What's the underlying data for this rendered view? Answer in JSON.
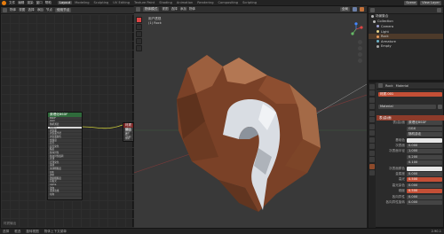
{
  "topbar": {
    "menus": [
      "文件",
      "编辑",
      "渲染",
      "窗口",
      "帮助"
    ],
    "workspaces": [
      "Layout",
      "Modeling",
      "Sculpting",
      "UV Editing",
      "Texture Paint",
      "Shading",
      "Animation",
      "Rendering",
      "Compositing",
      "Scripting"
    ],
    "active_workspace": "Layout",
    "scene_label": "Scene",
    "layer_label": "View Layer"
  },
  "node_editor": {
    "header_items": [
      "物体",
      "视图",
      "选择",
      "添加",
      "节点"
    ],
    "use_nodes_label": "使用节点",
    "node_main": {
      "title": "原理化BSDF",
      "rows": [
        "BSDF",
        "GGX",
        "随机游走",
        "基础色",
        "次表面",
        "次表面半径",
        "次表面颜色",
        "金属度",
        "高光",
        "高光染色",
        "糙度",
        "各向异性",
        "各向异性旋转",
        "光泽",
        "光泽染色",
        "清漆",
        "清漆粗糙度",
        "IOR",
        "透射",
        "透射粗糙度",
        "自发光",
        "Alpha",
        "法向",
        "清漆法线",
        "切向"
      ]
    },
    "node_output": {
      "title": "材质输出",
      "rows": [
        "全部",
        "表(曲)面",
        "体积(音量)",
        "置换"
      ]
    },
    "frame_label": "材质输出"
  },
  "viewport": {
    "header_items": [
      "物体模式",
      "视图",
      "选择",
      "添加",
      "物体"
    ],
    "shading_label": "全局",
    "overlay_text": [
      "用户透视",
      "(1) Rock"
    ]
  },
  "outliner": {
    "title": "场景集合",
    "rows": [
      {
        "label": "Collection",
        "kind": "collection"
      },
      {
        "label": "Camera",
        "kind": "camera"
      },
      {
        "label": "Light",
        "kind": "light"
      },
      {
        "label": "Rock",
        "kind": "mesh",
        "selected": true
      },
      {
        "label": "Armature",
        "kind": "armature"
      },
      {
        "label": "Empty",
        "kind": "empty"
      }
    ]
  },
  "properties": {
    "object_name": "Rock",
    "material_name": "Material",
    "slot_name": "材质.001",
    "section_surface": "表(曲)面",
    "surface_label": "表(曲)面",
    "surface_value": "原理化BSDF",
    "distribution_value": "GGX",
    "subsurface_method": "随机游走",
    "rows": [
      {
        "label": "基础色",
        "value": "",
        "style": "white"
      },
      {
        "label": "次表面",
        "value": "0.000",
        "style": ""
      },
      {
        "label": "次表面半径",
        "value": "1.000",
        "style": ""
      },
      {
        "label": "",
        "value": "0.200",
        "style": ""
      },
      {
        "label": "",
        "value": "0.100",
        "style": ""
      },
      {
        "label": "次表面颜色",
        "value": "",
        "style": "white"
      },
      {
        "label": "金属度",
        "value": "0.000",
        "style": ""
      },
      {
        "label": "高光",
        "value": "0.500",
        "style": "red"
      },
      {
        "label": "高光染色",
        "value": "0.000",
        "style": ""
      },
      {
        "label": "糙度",
        "value": "0.500",
        "style": "red"
      },
      {
        "label": "各向异性",
        "value": "0.000",
        "style": ""
      },
      {
        "label": "各向异性旋转",
        "value": "0.000",
        "style": ""
      }
    ]
  },
  "status_bar": {
    "items": [
      "选择",
      "框选",
      "旋转视图",
      "物体上下文菜单"
    ],
    "version": "2.90.1"
  },
  "colors": {
    "accent": "#e87d0d",
    "selection": "#c44f36",
    "rock_dark": "#6b3a22",
    "rock_light": "#b07450",
    "stone_white": "#d9dde3"
  }
}
